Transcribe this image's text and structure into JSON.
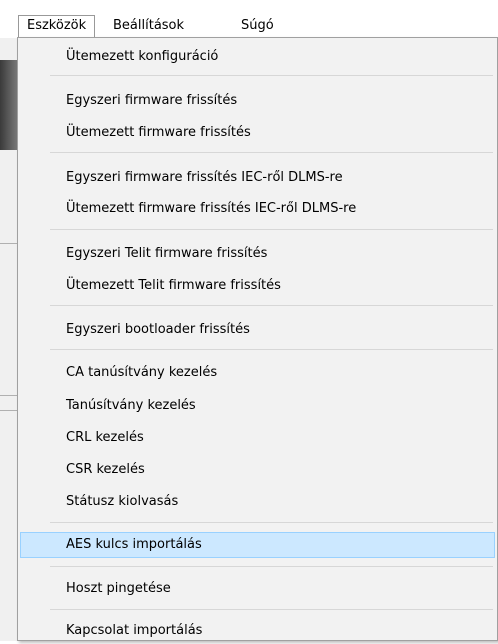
{
  "menubar": {
    "items": [
      {
        "label": "Eszközök",
        "active": true
      },
      {
        "label": "Beállítások",
        "active": false
      },
      {
        "label": "Súgó",
        "active": false
      }
    ]
  },
  "menu": {
    "highlight_color": "#cce8ff",
    "highlight_border": "#99d1ff",
    "items": [
      {
        "label": "Ütemezett konfiguráció"
      },
      {
        "label": "Egyszeri firmware frissítés"
      },
      {
        "label": "Ütemezett firmware frissítés"
      },
      {
        "label": "Egyszeri firmware frissítés IEC-ről DLMS-re"
      },
      {
        "label": "Ütemezett firmware frissítés IEC-ről DLMS-re"
      },
      {
        "label": "Egyszeri Telit firmware frissítés"
      },
      {
        "label": "Ütemezett Telit firmware frissítés"
      },
      {
        "label": "Egyszeri bootloader frissítés"
      },
      {
        "label": "CA tanúsítvány kezelés"
      },
      {
        "label": "Tanúsítvány kezelés"
      },
      {
        "label": "CRL kezelés"
      },
      {
        "label": "CSR kezelés"
      },
      {
        "label": "Státusz kiolvasás"
      },
      {
        "label": "AES kulcs importálás",
        "highlighted": true
      },
      {
        "label": "Hoszt pingetése"
      },
      {
        "label": "Kapcsolat importálás"
      }
    ]
  }
}
